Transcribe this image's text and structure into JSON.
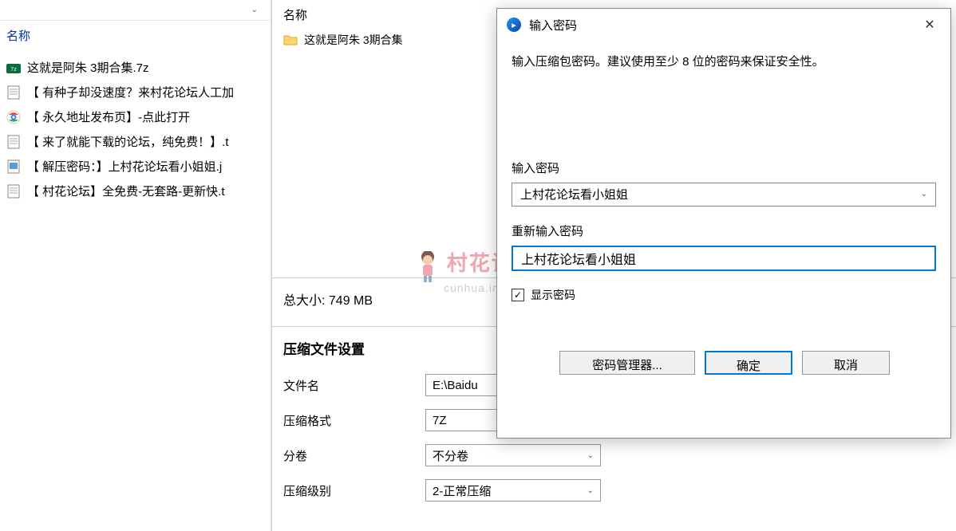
{
  "left_panel": {
    "column_header": "名称",
    "files": [
      {
        "icon": "7z",
        "name": "这就是阿朱 3期合集.7z"
      },
      {
        "icon": "txt",
        "name": "【 有种子却没速度？来村花论坛人工加"
      },
      {
        "icon": "html",
        "name": "【 永久地址发布页】-点此打开"
      },
      {
        "icon": "txt",
        "name": "【 来了就能下载的论坛，纯免费！】.t"
      },
      {
        "icon": "img",
        "name": "【 解压密码：】上村花论坛看小姐姐.j"
      },
      {
        "icon": "txt",
        "name": "【 村花论坛】全免费-无套路-更新快.t"
      }
    ]
  },
  "middle_panel": {
    "column_header": "名称",
    "folder_name": "这就是阿朱 3期合集",
    "total_size_label": "总大小:",
    "total_size_value": "749 MB",
    "section_title": "压缩文件设置",
    "rows": {
      "filename_label": "文件名",
      "filename_value": "E:\\Baidu",
      "format_label": "压缩格式",
      "format_value": "7Z",
      "split_label": "分卷",
      "split_value": "不分卷",
      "level_label": "压缩级别",
      "level_value": "2-正常压缩"
    }
  },
  "dialog": {
    "title": "输入密码",
    "instruction": "输入压缩包密码。建议使用至少 8 位的密码来保证安全性。",
    "password_label": "输入密码",
    "password_value": "上村花论坛看小姐姐",
    "confirm_label": "重新输入密码",
    "confirm_value": "上村花论坛看小姐姐",
    "show_password_label": "显示密码",
    "show_password_checked": true,
    "buttons": {
      "password_manager": "密码管理器...",
      "ok": "确定",
      "cancel": "取消"
    }
  },
  "watermark": {
    "main": "村花论坛",
    "sub": "cunhua.im"
  }
}
